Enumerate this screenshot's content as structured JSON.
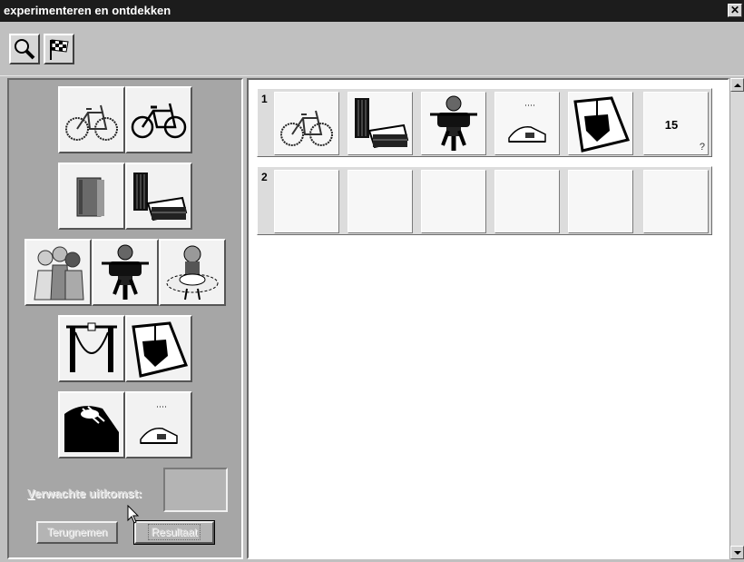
{
  "window": {
    "title": "experimenteren en ontdekken",
    "close_label": "✕"
  },
  "toolbar": {
    "buttons": [
      {
        "icon": "magnifier-icon"
      },
      {
        "icon": "checkered-flag-icon"
      }
    ]
  },
  "left_panel": {
    "tile_groups": [
      {
        "items": [
          "bicycle-icon",
          "bicycle-icon"
        ]
      },
      {
        "items": [
          "book-icon",
          "books-stack-icon"
        ]
      },
      {
        "items": [
          "people-group-icon",
          "cyclist-icon",
          "child-in-tutu-icon"
        ]
      },
      {
        "items": [
          "coat-hanger-icon",
          "boat-icon"
        ]
      },
      {
        "items": [
          "large-shoe-icon",
          "small-shoe-icon"
        ]
      }
    ],
    "expected_label_prefix": "V",
    "expected_label_rest": "erwachte uitkomst:",
    "expected_value": "",
    "undo_button": "Terugnemen",
    "result_button": "Resultaat"
  },
  "result_rows": [
    {
      "number": "1",
      "slots": [
        "bicycle-icon",
        "books-stack-icon",
        "cyclist-icon",
        "small-shoe-icon",
        "boat-icon"
      ],
      "result_value": "15",
      "result_mark": "?"
    },
    {
      "number": "2",
      "slots": [
        "",
        "",
        "",
        "",
        ""
      ],
      "result_value": "",
      "result_mark": ""
    }
  ]
}
